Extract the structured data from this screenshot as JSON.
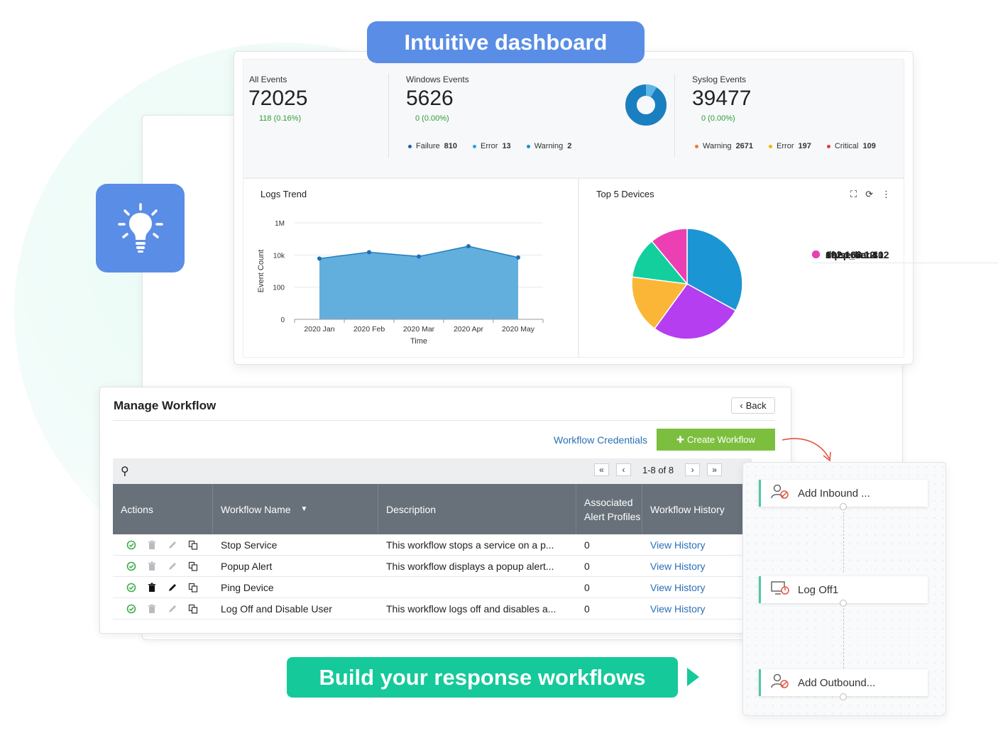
{
  "banners": {
    "top": "Intuitive dashboard",
    "bottom": "Build your response workflows"
  },
  "colors": {
    "accent_blue": "#5a8de6",
    "accent_green": "#15c99a",
    "create_btn": "#7cbf3f",
    "link": "#2a6fb8"
  },
  "summary": {
    "all": {
      "label": "All Events",
      "value": "72025",
      "change": "118 (0.16%)"
    },
    "windows": {
      "label": "Windows Events",
      "value": "5626",
      "change": "0 (0.00%)",
      "legend": [
        {
          "label": "Failure",
          "value": "810",
          "color": "#1f5fa8"
        },
        {
          "label": "Error",
          "value": "13",
          "color": "#29a6df"
        },
        {
          "label": "Warning",
          "value": "2",
          "color": "#1990c8"
        }
      ]
    },
    "syslog": {
      "label": "Syslog Events",
      "value": "39477",
      "change": "0 (0.00%)",
      "legend": [
        {
          "label": "Warning",
          "value": "2671",
          "color": "#f07b2b"
        },
        {
          "label": "Error",
          "value": "197",
          "color": "#f5b400"
        },
        {
          "label": "Critical",
          "value": "109",
          "color": "#e03d3d"
        }
      ]
    }
  },
  "logs_trend": {
    "title": "Logs Trend"
  },
  "top_devices": {
    "title": "Top 5 Devices"
  },
  "chart_data": [
    {
      "type": "area",
      "title": "Logs Trend",
      "xlabel": "Time",
      "ylabel": "Event Count",
      "categories": [
        "2020 Jan",
        "2020 Feb",
        "2020 Mar",
        "2020 Apr",
        "2020 May"
      ],
      "y_ticks": [
        "0",
        "100",
        "10k",
        "1M"
      ],
      "y_scale": "log",
      "values": [
        6000,
        15000,
        8000,
        35000,
        7000
      ],
      "grid": true,
      "color": "#5aabdc"
    },
    {
      "type": "pie",
      "title": "Top 5 Devices",
      "legend_position": "right",
      "labels": [
        "192.168.12.12",
        "dhcp_linux",
        "sqlserver",
        "192.168.1.10",
        "192.168.1.4"
      ],
      "values": [
        33,
        27,
        17,
        12,
        11
      ],
      "colors": [
        "#1b95d3",
        "#b43ef0",
        "#fbb637",
        "#13cf9d",
        "#ec3fb4"
      ]
    }
  ],
  "workflow": {
    "title": "Manage Workflow",
    "back_label": "Back",
    "credentials_link": "Workflow Credentials",
    "create_label": "Create Workflow",
    "pager": {
      "range": "1-8 of 8"
    },
    "columns": [
      "Actions",
      "Workflow Name",
      "Description",
      "Associated Alert Profiles",
      "Workflow History"
    ],
    "rows": [
      {
        "name": "Stop Service",
        "description": "This workflow stops a service on a p...",
        "profiles": "0",
        "history": "View History"
      },
      {
        "name": "Popup Alert",
        "description": "This workflow displays a popup alert...",
        "profiles": "0",
        "history": "View History"
      },
      {
        "name": "Ping Device",
        "description": "",
        "profiles": "0",
        "history": "View History"
      },
      {
        "name": "Log Off and Disable User",
        "description": "This workflow logs off and disables a...",
        "profiles": "0",
        "history": "View History"
      }
    ]
  },
  "flow": {
    "nodes": [
      {
        "label": "Add Inbound ...",
        "icon": "user-block-icon"
      },
      {
        "label": "Log Off1",
        "icon": "monitor-power-icon"
      },
      {
        "label": "Add Outbound...",
        "icon": "user-block-icon"
      }
    ]
  }
}
